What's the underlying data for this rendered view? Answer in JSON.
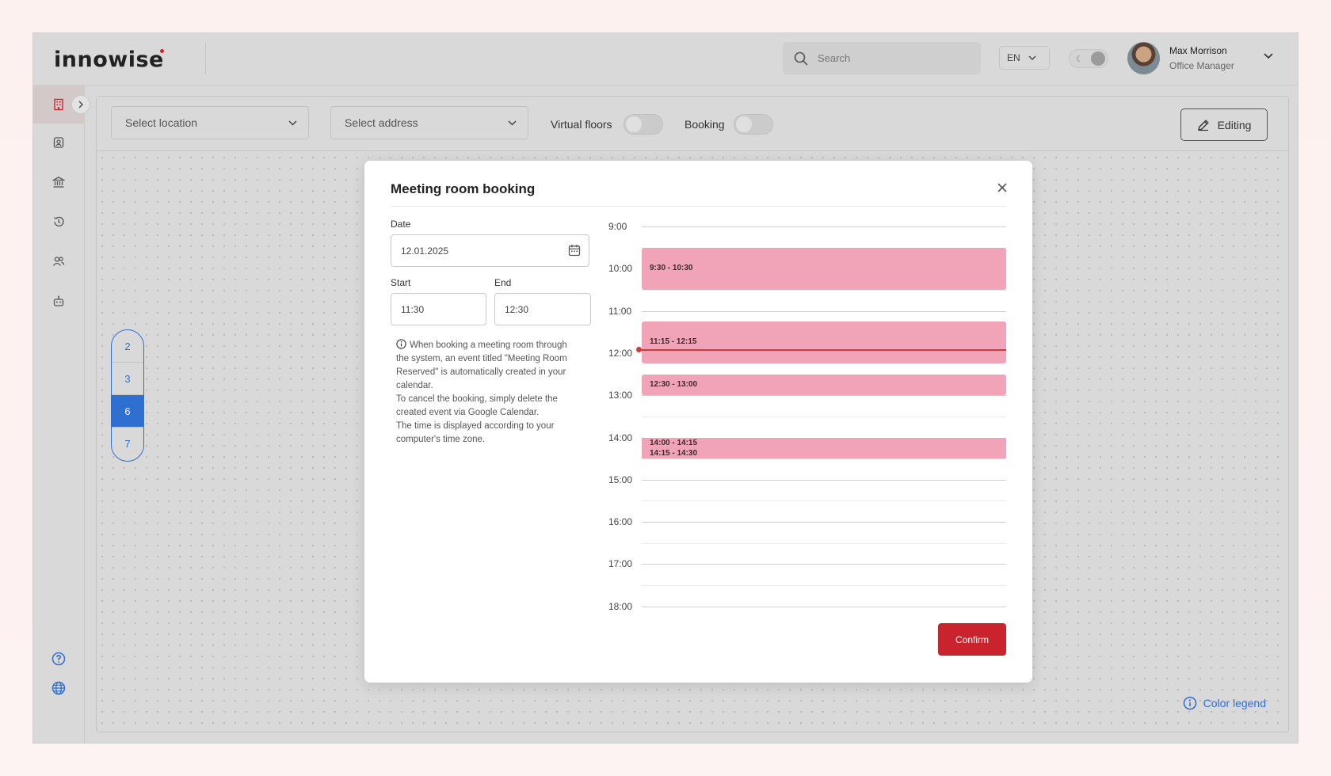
{
  "header": {
    "logo_text": "innowise",
    "search_placeholder": "Search",
    "language": "EN",
    "user_name": "Max Morrison",
    "user_role": "Office Manager"
  },
  "sidebar": {
    "items": [
      "building-icon",
      "badge-icon",
      "bank-icon",
      "history-icon",
      "users-icon",
      "robot-icon"
    ],
    "bottom": [
      "help-icon",
      "globe-icon"
    ]
  },
  "toolbar": {
    "location_placeholder": "Select location",
    "address_placeholder": "Select address",
    "virtual_floors_label": "Virtual floors",
    "booking_label": "Booking",
    "editing_label": "Editing"
  },
  "floors": [
    "2",
    "3",
    "6",
    "7"
  ],
  "active_floor": "6",
  "color_legend_label": "Color legend",
  "modal": {
    "title": "Meeting room booking",
    "date_label": "Date",
    "date_value": "12.01.2025",
    "start_label": "Start",
    "start_value": "11:30",
    "end_label": "End",
    "end_value": "12:30",
    "info_lines": [
      "When booking a meeting room through the system, an event titled \"Meeting Room Reserved\" is automatically created in your calendar.",
      "To cancel the booking, simply delete the created event via Google Calendar.",
      "The time is displayed according to your computer's time zone."
    ],
    "hours": [
      "9:00",
      "10:00",
      "11:00",
      "12:00",
      "13:00",
      "14:00",
      "15:00",
      "16:00",
      "17:00",
      "18:00"
    ],
    "bookings": [
      {
        "label": "9:30 - 10:30",
        "start": 9.5,
        "end": 10.5
      },
      {
        "label": "11:15 - 12:15",
        "start": 11.25,
        "end": 12.25
      },
      {
        "label": "12:30 - 13:00",
        "start": 12.5,
        "end": 13.0
      },
      {
        "label": "14:00 - 14:15",
        "start": 14.0,
        "end": 14.25
      },
      {
        "label": "14:15 - 14:30",
        "start": 14.25,
        "end": 14.5
      }
    ],
    "current_time": 11.9,
    "confirm_label": "Confirm"
  },
  "colors": {
    "accent_red": "#c9232d",
    "booking_pink": "#f1a4b7",
    "link_blue": "#2f6fd0"
  }
}
